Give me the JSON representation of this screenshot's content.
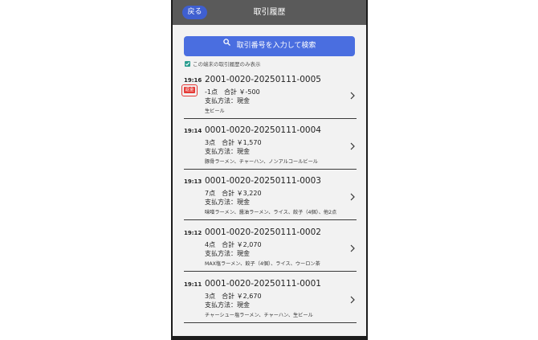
{
  "header": {
    "back_label": "戻る",
    "title": "取引履歴"
  },
  "search": {
    "label": "取引番号を入力して検索",
    "icon": "search-icon"
  },
  "filter": {
    "label": "この端末の取引履歴のみ表示",
    "checked": true
  },
  "transactions": [
    {
      "time": "19:16",
      "badge": "返金",
      "number": "2001-0020-20250111-0005",
      "summary": "-1点　合計 ￥-500",
      "payment": "支払方法：現金",
      "items": "生ビール"
    },
    {
      "time": "19:14",
      "number": "0001-0020-20250111-0004",
      "summary": "3点　合計 ￥1,570",
      "payment": "支払方法：現金",
      "items": "豚骨ラーメン、チャーハン、ノンアルコールビール"
    },
    {
      "time": "19:13",
      "number": "0001-0020-20250111-0003",
      "summary": "7点　合計 ￥3,220",
      "payment": "支払方法：現金",
      "items": "味噌ラーメン、醤油ラーメン、ライス、餃子（4個）、他2点"
    },
    {
      "time": "19:12",
      "number": "0001-0020-20250111-0002",
      "summary": "4点　合計 ￥2,070",
      "payment": "支払方法：現金",
      "items": "MAX塩ラーメン、餃子（4個）、ライス、ウーロン茶"
    },
    {
      "time": "19:11",
      "number": "0001-0020-20250111-0001",
      "summary": "3点　合計 ￥2,670",
      "payment": "支払方法：現金",
      "items": "チャーシュー塩ラーメン、チャーハン、生ビール"
    }
  ],
  "colors": {
    "header_bg": "#5a5a5a",
    "primary": "#4a6ee0",
    "refund": "#e53935",
    "background": "#f2f2f2"
  }
}
